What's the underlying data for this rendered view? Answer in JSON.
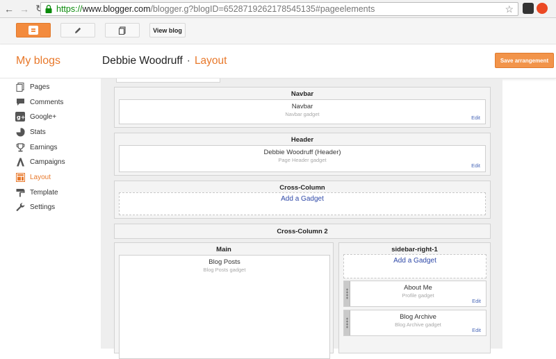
{
  "browser": {
    "url_scheme": "https://",
    "url_host": "www.blogger.com",
    "url_path": "/blogger.g?blogID=6528719262178545135#pageelements"
  },
  "toolbar": {
    "view_blog_label": "View blog"
  },
  "header": {
    "my_blogs": "My blogs",
    "blog_name": "Debbie Woodruff",
    "separator": "·",
    "section": "Layout",
    "save_label": "Save arrangement"
  },
  "sidebar": {
    "items": [
      {
        "label": "Pages",
        "icon": "pages-icon"
      },
      {
        "label": "Comments",
        "icon": "comments-icon"
      },
      {
        "label": "Google+",
        "icon": "google-plus-icon"
      },
      {
        "label": "Stats",
        "icon": "stats-icon"
      },
      {
        "label": "Earnings",
        "icon": "trophy-icon"
      },
      {
        "label": "Campaigns",
        "icon": "campaigns-icon"
      },
      {
        "label": "Layout",
        "icon": "layout-icon",
        "active": true
      },
      {
        "label": "Template",
        "icon": "template-icon"
      },
      {
        "label": "Settings",
        "icon": "wrench-icon"
      }
    ]
  },
  "layout": {
    "navbar": {
      "title": "Navbar",
      "gadget_title": "Navbar",
      "gadget_sub": "Navbar gadget",
      "edit": "Edit"
    },
    "header": {
      "title": "Header",
      "gadget_title": "Debbie Woodruff (Header)",
      "gadget_sub": "Page Header gadget",
      "edit": "Edit"
    },
    "cross_column": {
      "title": "Cross-Column",
      "add_gadget": "Add a Gadget"
    },
    "cross_column_2": {
      "title": "Cross-Column 2"
    },
    "main": {
      "title": "Main",
      "gadget_title": "Blog Posts",
      "gadget_sub": "Blog Posts gadget"
    },
    "sidebar_right": {
      "title": "sidebar-right-1",
      "add_gadget": "Add a Gadget",
      "gadgets": [
        {
          "title": "About Me",
          "sub": "Profile gadget",
          "edit": "Edit"
        },
        {
          "title": "Blog Archive",
          "sub": "Blog Archive gadget",
          "edit": "Edit"
        }
      ]
    }
  },
  "colors": {
    "accent": "#e8782a",
    "link": "#2f49a8"
  }
}
